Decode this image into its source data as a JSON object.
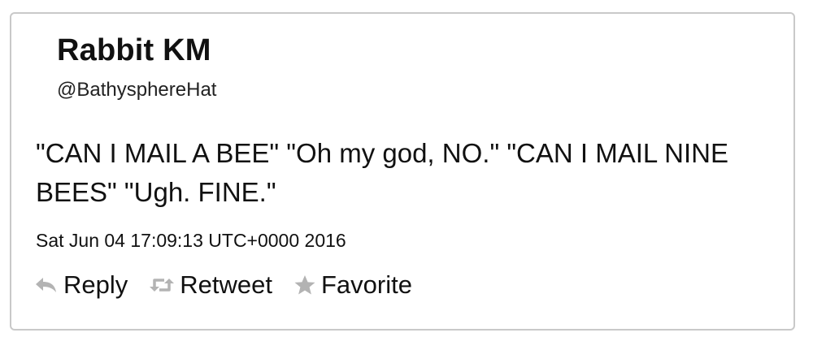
{
  "tweet": {
    "author_name": "Rabbit KM",
    "author_handle": "@BathysphereHat",
    "text": "\"CAN I MAIL A BEE\" \"Oh my god, NO.\" \"CAN I MAIL NINE BEES\" \"Ugh. FINE.\"",
    "timestamp": "Sat Jun 04 17:09:13 UTC+0000 2016"
  },
  "actions": {
    "reply_label": "Reply",
    "retweet_label": "Retweet",
    "favorite_label": "Favorite"
  },
  "icons": {
    "reply": "reply-arrow-icon",
    "retweet": "retweet-icon",
    "favorite": "star-icon"
  },
  "colors": {
    "border": "#c9c9c9",
    "icon": "#b3b3b3",
    "text": "#111111"
  }
}
